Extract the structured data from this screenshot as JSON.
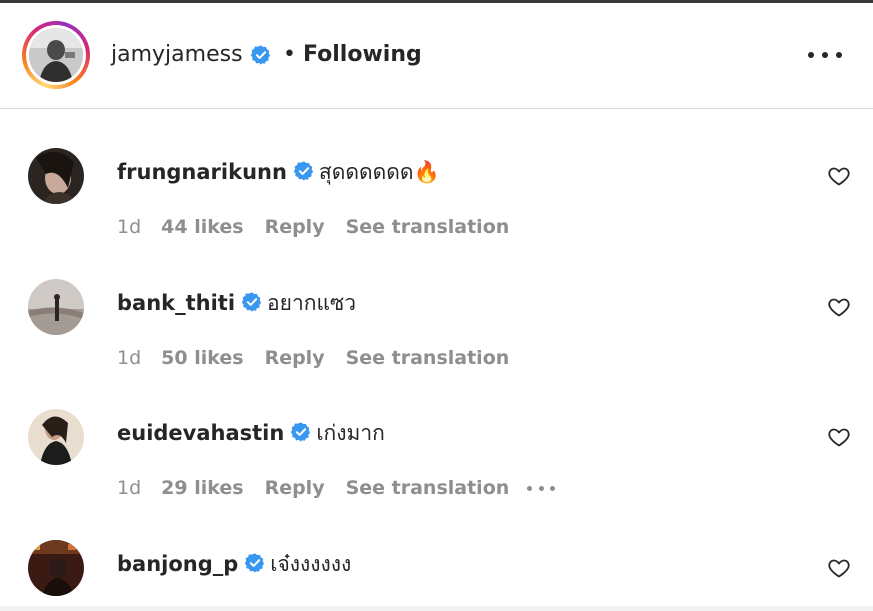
{
  "header": {
    "username": "jamyjamess",
    "separator": "•",
    "follow_status": "Following",
    "more_options_icon": "more-horizontal-icon"
  },
  "comments": [
    {
      "username": "frungnarikunn",
      "verified": true,
      "text": "สุดดดดดด🔥",
      "time": "1d",
      "likes": "44 likes",
      "reply": "Reply",
      "translate": "See translation"
    },
    {
      "username": "bank_thiti",
      "verified": true,
      "text": "อยากแซว",
      "time": "1d",
      "likes": "50 likes",
      "reply": "Reply",
      "translate": "See translation"
    },
    {
      "username": "euidevahastin",
      "verified": true,
      "text": "เก่งมาก",
      "time": "1d",
      "likes": "29 likes",
      "reply": "Reply",
      "translate": "See translation"
    },
    {
      "username": "banjong_p",
      "verified": true,
      "text": "เจ๋งงงงงง"
    }
  ],
  "colors": {
    "verified_blue": "#3897f0",
    "muted_text": "#8e8e8e",
    "primary_text": "#262626"
  }
}
